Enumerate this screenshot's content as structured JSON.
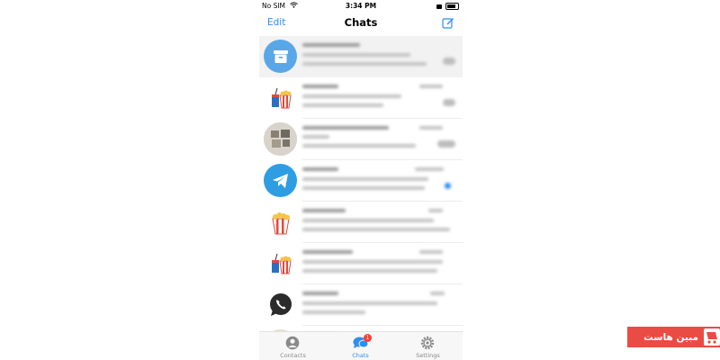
{
  "status_bar": {
    "carrier": "No SIM",
    "time": "3:34 PM"
  },
  "nav": {
    "edit_label": "Edit",
    "title": "Chats",
    "compose_icon": "compose-icon"
  },
  "chats": [
    {
      "avatar_icon": "archive-icon",
      "avatar_color": "#5aa7e8"
    },
    {
      "avatar_icon": "popcorn-drink-icon"
    },
    {
      "avatar_icon": "group-photo-avatar"
    },
    {
      "avatar_icon": "telegram-icon",
      "avatar_color": "#2f9de2"
    },
    {
      "avatar_icon": "popcorn-icon"
    },
    {
      "avatar_icon": "popcorn-drink-icon"
    },
    {
      "avatar_icon": "whatsapp-icon",
      "avatar_color": "#2b2b2b"
    },
    {
      "avatar_icon": "photo-avatar"
    }
  ],
  "tabs": [
    {
      "label": "Contacts",
      "icon": "contacts-icon"
    },
    {
      "label": "Chats",
      "icon": "chats-icon",
      "badge": "1"
    },
    {
      "label": "Settings",
      "icon": "settings-icon"
    }
  ],
  "watermark": {
    "text": "مبین هاست",
    "brand_color": "#ea4b43"
  },
  "colors": {
    "accent": "#2f8ef0",
    "badge": "#ff3b30"
  }
}
